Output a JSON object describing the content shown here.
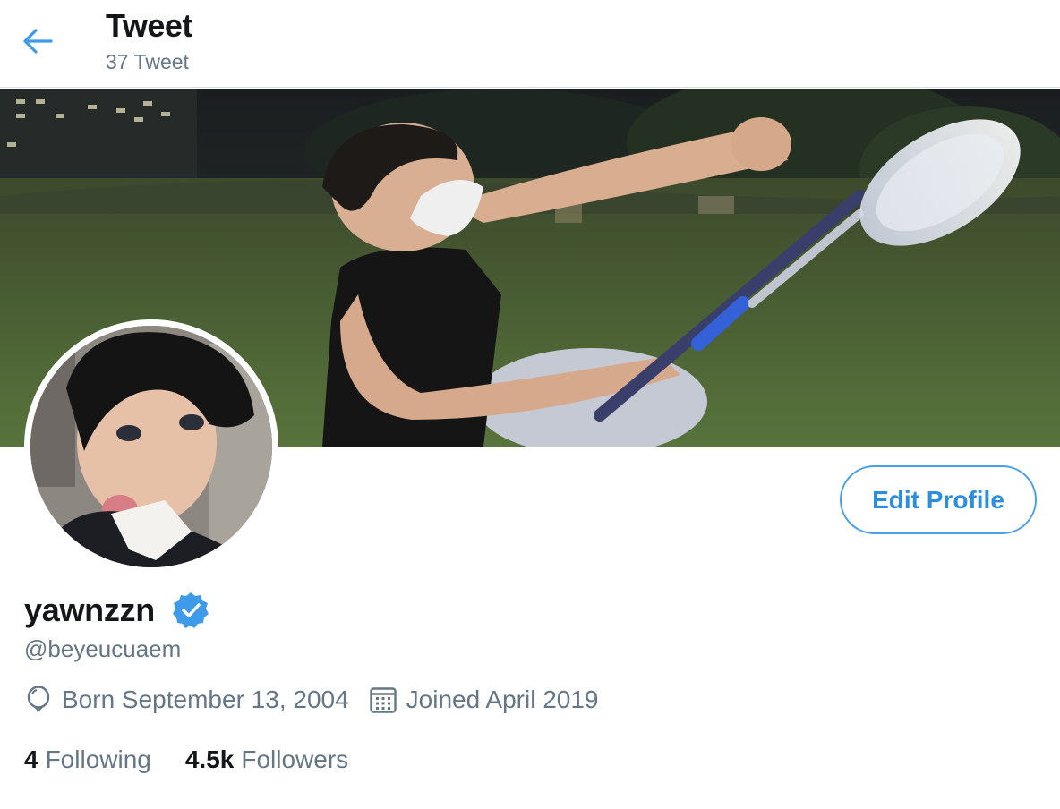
{
  "header": {
    "title": "Tweet",
    "subtitle": "37 Tweet",
    "back_icon": "arrow-left-icon"
  },
  "profile": {
    "name": "yawnzzn",
    "handle": "@beyeucuaem",
    "verified": true,
    "edit_button_label": "Edit Profile",
    "born": "Born September 13, 2004",
    "joined": "Joined April 2019",
    "following_count": "4",
    "following_label": "Following",
    "followers_count": "4.5k",
    "followers_label": "Followers"
  },
  "colors": {
    "accent": "#1da1f2",
    "muted_text": "#657786"
  },
  "icons": {
    "birthday": "balloon-icon",
    "joined": "calendar-icon",
    "verified": "verified-badge-icon"
  }
}
